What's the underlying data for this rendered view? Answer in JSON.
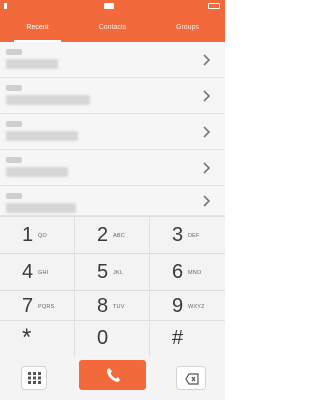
{
  "tabs": [
    {
      "label": "Recent"
    },
    {
      "label": "Contacts"
    },
    {
      "label": "Groups"
    }
  ],
  "keys": [
    {
      "digit": "1",
      "letters": "QO"
    },
    {
      "digit": "2",
      "letters": "ABC"
    },
    {
      "digit": "3",
      "letters": "DEF"
    },
    {
      "digit": "4",
      "letters": "GHI"
    },
    {
      "digit": "5",
      "letters": "JKL"
    },
    {
      "digit": "6",
      "letters": "MNO"
    },
    {
      "digit": "7",
      "letters": "PQRS"
    },
    {
      "digit": "8",
      "letters": "TUV"
    },
    {
      "digit": "9",
      "letters": "WXYZ"
    }
  ],
  "bottom_row": {
    "star": "*",
    "zero": "0",
    "hash": "#"
  },
  "colors": {
    "accent": "#f26a3c"
  }
}
